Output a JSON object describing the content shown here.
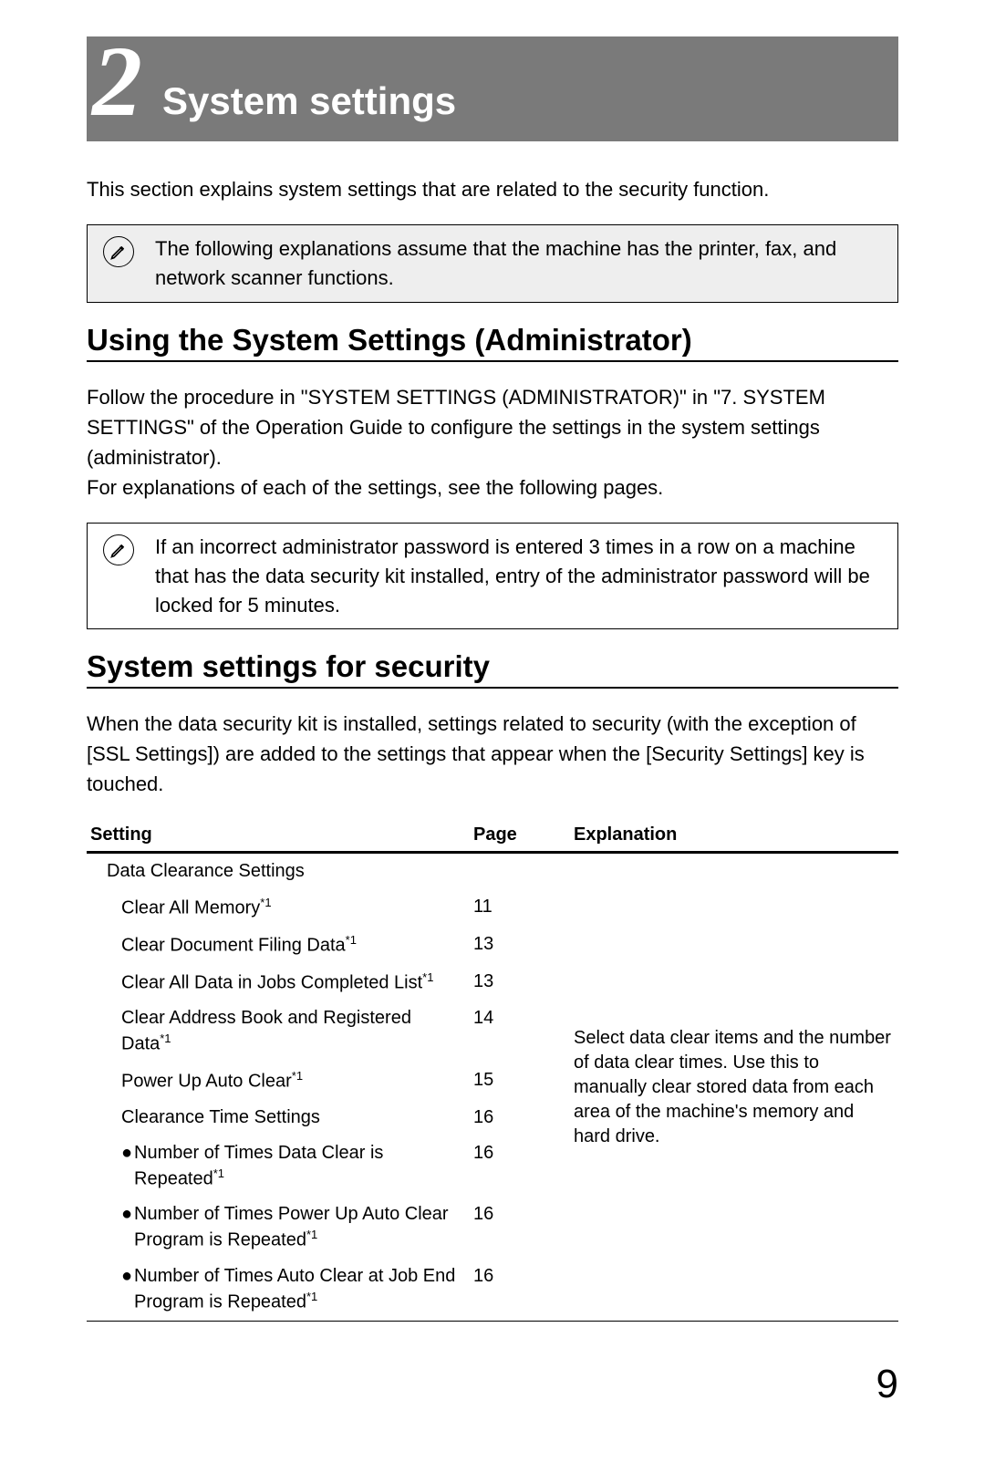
{
  "chapter": {
    "number": "2",
    "title": "System settings"
  },
  "intro": "This section explains system settings that are related to the security function.",
  "note1": "The following explanations assume that the machine has the printer, fax, and network scanner functions.",
  "heading1": "Using the System Settings (Administrator)",
  "para1": "Follow the procedure in \"SYSTEM SETTINGS (ADMINISTRATOR)\" in \"7. SYSTEM SETTINGS\" of the Operation Guide to configure the settings in the system settings (administrator).\nFor explanations of each of the settings, see the following pages.",
  "note2": "If an incorrect administrator password is entered 3 times in a row on a machine that has the data security kit installed, entry of the administrator password will be locked for 5 minutes.",
  "heading2": "System settings for security",
  "para2": "When the data security kit is installed, settings related to security (with the exception of [SSL Settings]) are added to the settings that appear when the [Security Settings] key is touched.",
  "table": {
    "headers": {
      "setting": "Setting",
      "page": "Page",
      "explanation": "Explanation"
    },
    "group_header": "Data Clearance Settings",
    "sup": "*1",
    "rows": [
      {
        "label": "Clear All Memory",
        "sup": true,
        "page": "11",
        "bullet": false
      },
      {
        "label": "Clear Document Filing Data",
        "sup": true,
        "page": "13",
        "bullet": false
      },
      {
        "label": "Clear All Data in Jobs Completed List",
        "sup": true,
        "page": "13",
        "bullet": false
      },
      {
        "label": "Clear Address Book and Registered Data",
        "sup": true,
        "page": "14",
        "bullet": false
      },
      {
        "label": "Power Up Auto Clear",
        "sup": true,
        "page": "15",
        "bullet": false
      },
      {
        "label": "Clearance Time Settings",
        "sup": false,
        "page": "16",
        "bullet": false
      },
      {
        "label": "Number of Times Data Clear is Repeated",
        "sup": true,
        "page": "16",
        "bullet": true
      },
      {
        "label": "Number of Times Power Up Auto Clear Program is Repeated",
        "sup": true,
        "page": "16",
        "bullet": true
      },
      {
        "label": "Number of Times Auto Clear at Job End Program is Repeated",
        "sup": true,
        "page": "16",
        "bullet": true
      }
    ],
    "explanation": "Select data clear items and the number of data clear times. Use this to manually clear stored data from each area of the machine's memory and hard drive."
  },
  "page_number": "9"
}
